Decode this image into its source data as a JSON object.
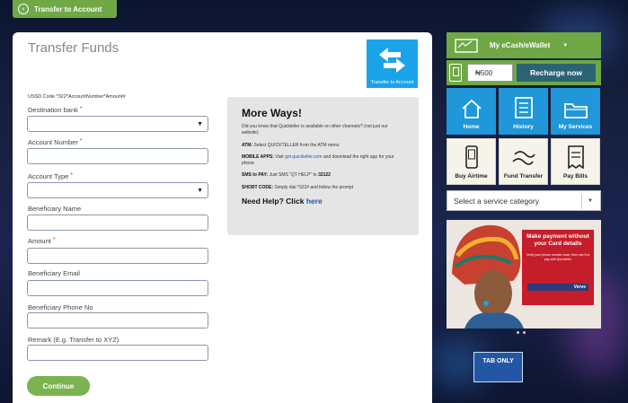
{
  "header": {
    "back_tab_label": "Transfer to Account"
  },
  "form": {
    "title": "Transfer Funds",
    "logo_label": "Transfer to Account",
    "ussd_code": "USSD Code *322*AccountNumber*Amount#",
    "fields": {
      "destination_bank": {
        "label": "Destination bank",
        "required_mark": "*"
      },
      "account_number": {
        "label": "Account Number",
        "required_mark": "*"
      },
      "account_type": {
        "label": "Account Type",
        "required_mark": "*"
      },
      "beneficiary_name": {
        "label": "Beneficiary Name"
      },
      "amount": {
        "label": "Amount",
        "required_mark": "*"
      },
      "beneficiary_email": {
        "label": "Beneficiary Email"
      },
      "beneficiary_phone": {
        "label": "Beneficiary Phone No"
      },
      "remark": {
        "label": "Remark (E.g. Transfer to XYZ)"
      }
    },
    "continue_label": "Continue"
  },
  "more_ways": {
    "title": "More Ways!",
    "intro": "Did you know that Quickteller is available on other channels? (not just our website)",
    "atm_label": "ATM:",
    "atm_text": "Select QUICKTELLER from the ATM menu",
    "mobile_label": "MOBILE APPS:",
    "mobile_text_pre": "Visit",
    "mobile_link": "get.quickteller.com",
    "mobile_text_post": "and download the right app for your phone",
    "sms_label": "SMS to PAY:",
    "sms_text": "Just SMS \"QT HELP\" to",
    "sms_number": "32122",
    "short_label": "SHORT CODE:",
    "short_text": "Simply dial *322# and follow the prompt",
    "help_text": "Need Help? Click",
    "help_link": "here"
  },
  "wallet": {
    "title": "My eCash/eWallet",
    "amount_placeholder": "₦500",
    "recharge_label": "Recharge now"
  },
  "tiles": [
    {
      "label": "Home",
      "icon": "home-icon"
    },
    {
      "label": "History",
      "icon": "history-icon"
    },
    {
      "label": "My Services",
      "icon": "folder-icon"
    },
    {
      "label": "Buy Airtime",
      "icon": "phone-icon"
    },
    {
      "label": "Fund Transfer",
      "icon": "transfer-icon"
    },
    {
      "label": "Pay Bills",
      "icon": "bill-icon"
    }
  ],
  "service_select": {
    "placeholder": "Select a service category"
  },
  "banner": {
    "headline": "Make payment without your Card details",
    "subtext": "Verify your phone number once, then use it to pay with Quickteller",
    "brand": "Verve"
  },
  "road_sign": {
    "text": "TAB ONLY"
  },
  "colors": {
    "green": "#6fa845",
    "blue": "#1f97d8",
    "dark_teal": "#2c6374",
    "red": "#c51d2a"
  }
}
